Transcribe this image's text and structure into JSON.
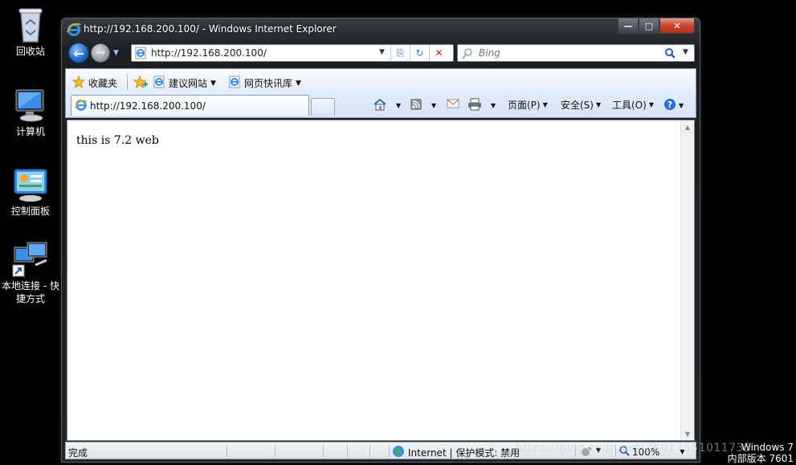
{
  "desktop": {
    "icons": [
      {
        "label": "回收站",
        "icon": "recycle-bin-icon"
      },
      {
        "label": "计算机",
        "icon": "computer-icon"
      },
      {
        "label": "控制面板",
        "icon": "control-panel-icon"
      },
      {
        "label": "本地连接 - 快捷方式",
        "icon": "network-shortcut-icon"
      }
    ],
    "os_line1": "Windows 7",
    "os_line2": "内部版本 7601",
    "watermark": "https://blog.csdn.net/ZK017551011735"
  },
  "window": {
    "title": "http://192.168.200.100/ - Windows Internet Explorer",
    "controls": {
      "minimize": "—",
      "maximize": "□",
      "close": "✕"
    }
  },
  "address_bar": {
    "url": "http://192.168.200.100/",
    "dropdown": "▼",
    "compat": "⎘",
    "refresh": "↻",
    "stop": "✕"
  },
  "search": {
    "placeholder": "Bing",
    "dropdown": "▼"
  },
  "favorites_bar": {
    "favorites_label": "收藏夹",
    "items": [
      {
        "label": "建议网站",
        "dropdown": "▼"
      },
      {
        "label": "网页快讯库",
        "dropdown": "▼"
      }
    ]
  },
  "tabs": [
    {
      "title": "http://192.168.200.100/",
      "active": true
    }
  ],
  "command_bar": {
    "items": [
      {
        "label": "页面(P)",
        "dropdown": "▼"
      },
      {
        "label": "安全(S)",
        "dropdown": "▼"
      },
      {
        "label": "工具(O)",
        "dropdown": "▼"
      }
    ],
    "home_dd": "▼",
    "feeds_dd": "▼",
    "print_dd": "▼",
    "help_dd": "▼"
  },
  "page": {
    "body_text": "this is 7.2 web"
  },
  "scrollbar": {
    "up": "▲",
    "down": "▼"
  },
  "status_bar": {
    "status": "完成",
    "zone": "Internet | 保护模式: 禁用",
    "zoom": "100%",
    "zoom_dd": "▼",
    "protect_dd": "▼"
  },
  "colors": {
    "desktop_bg": "#000000",
    "ie_blue": "#1f62c4",
    "close_red": "#c7452c"
  }
}
